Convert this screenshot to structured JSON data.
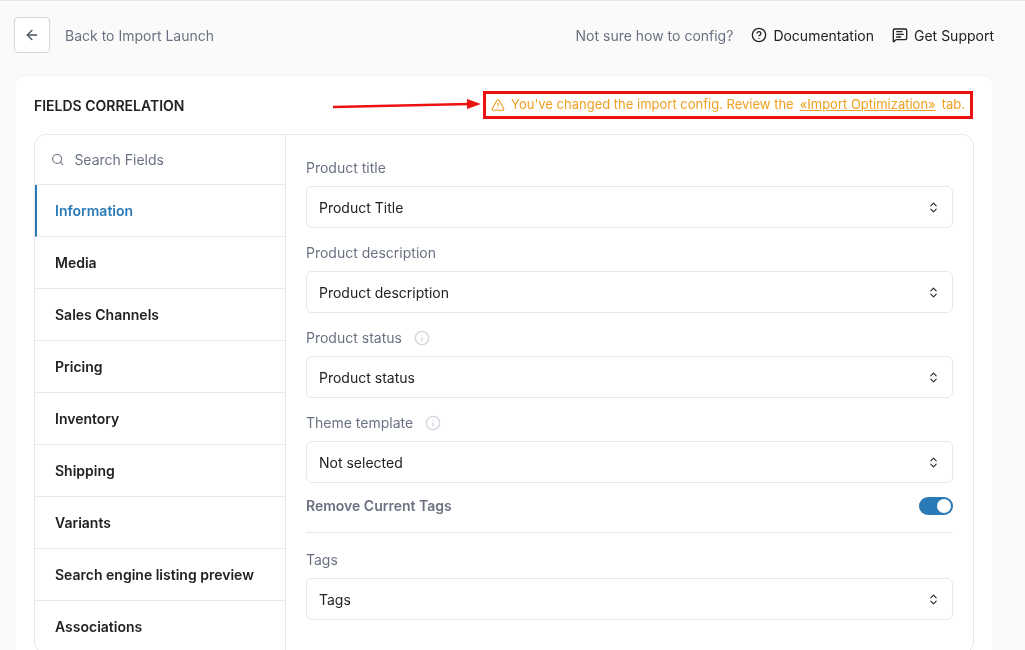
{
  "header": {
    "back_label": "Back to Import Launch",
    "help_text": "Not sure how to config?",
    "links": [
      {
        "kind": "docs",
        "label": "Documentation"
      },
      {
        "kind": "support",
        "label": "Get Support"
      }
    ]
  },
  "card": {
    "title": "FIELDS CORRELATION",
    "warning": {
      "before": "You've changed the import config. Review the",
      "link": "«Import Optimization»",
      "after": "tab."
    }
  },
  "search": {
    "placeholder": "Search Fields"
  },
  "sections": [
    {
      "label": "Information",
      "selected": true
    },
    {
      "label": "Media",
      "selected": false
    },
    {
      "label": "Sales Channels",
      "selected": false
    },
    {
      "label": "Pricing",
      "selected": false
    },
    {
      "label": "Inventory",
      "selected": false
    },
    {
      "label": "Shipping",
      "selected": false
    },
    {
      "label": "Variants",
      "selected": false
    },
    {
      "label": "Search engine listing preview",
      "selected": false
    },
    {
      "label": "Associations",
      "selected": false
    }
  ],
  "fields": [
    {
      "kind": "select",
      "label": "Product title",
      "info": false,
      "value": "Product Title"
    },
    {
      "kind": "select",
      "label": "Product description",
      "info": false,
      "value": "Product description"
    },
    {
      "kind": "select",
      "label": "Product status",
      "info": true,
      "value": "Product status"
    },
    {
      "kind": "select",
      "label": "Theme template",
      "info": true,
      "value": "Not selected"
    },
    {
      "kind": "toggle",
      "label": "Remove Current Tags",
      "on": true
    },
    {
      "kind": "select",
      "label": "Tags",
      "info": false,
      "value": "Tags"
    }
  ]
}
